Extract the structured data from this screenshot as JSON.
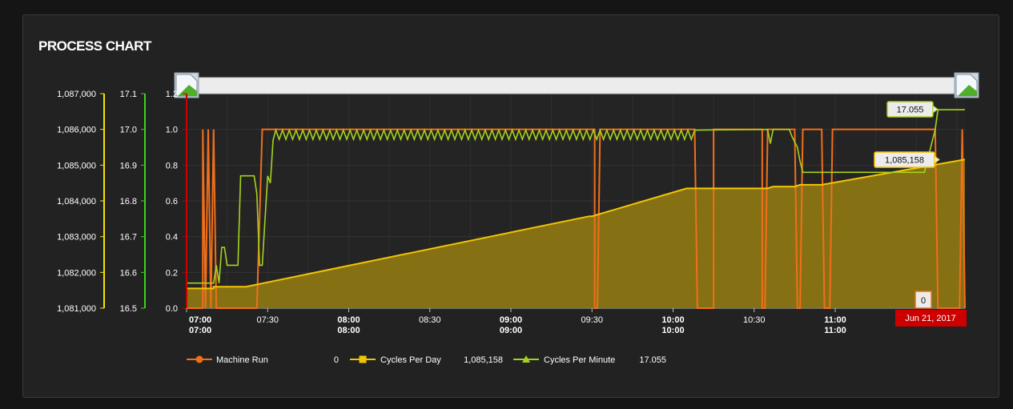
{
  "panel_title": "PROCESS CHART",
  "colors": {
    "machine_run": "#f26f1a",
    "cycles_per_day": "#f2c500",
    "cycles_per_day_fill": "#8b7514",
    "cycles_per_minute": "#a5d21e",
    "axis_day": "#f2e600",
    "axis_minute": "#3cd21e",
    "axis_run": "#cc0000",
    "date_flag": "#cc0000"
  },
  "chart_data": {
    "type": "line",
    "title": "PROCESS CHART",
    "x_range": [
      "07:00",
      "11:48"
    ],
    "x_ticks": [
      {
        "t": "07:00",
        "line1": "07:00",
        "line2": "07:00",
        "bold": true
      },
      {
        "t": "07:30",
        "line1": "07:30",
        "line2": "",
        "bold": false
      },
      {
        "t": "08:00",
        "line1": "08:00",
        "line2": "08:00",
        "bold": true
      },
      {
        "t": "08:30",
        "line1": "08:30",
        "line2": "",
        "bold": false
      },
      {
        "t": "09:00",
        "line1": "09:00",
        "line2": "09:00",
        "bold": true
      },
      {
        "t": "09:30",
        "line1": "09:30",
        "line2": "",
        "bold": false
      },
      {
        "t": "10:00",
        "line1": "10:00",
        "line2": "10:00",
        "bold": true
      },
      {
        "t": "10:30",
        "line1": "10:30",
        "line2": "",
        "bold": false
      },
      {
        "t": "11:00",
        "line1": "11:00",
        "line2": "11:00",
        "bold": true
      }
    ],
    "y_axes": {
      "cycles_per_day": {
        "min": 1081000,
        "max": 1087000,
        "ticks": [
          "1,081,000",
          "1,082,000",
          "1,083,000",
          "1,084,000",
          "1,085,000",
          "1,086,000",
          "1,087,000"
        ]
      },
      "cycles_per_minute": {
        "min": 16.5,
        "max": 17.1,
        "ticks": [
          "16.5",
          "16.6",
          "16.7",
          "16.8",
          "16.9",
          "17.0",
          "17.1"
        ]
      },
      "machine_run": {
        "min": 0,
        "max": 1.2,
        "ticks": [
          "0.0",
          "0.2",
          "0.4",
          "0.6",
          "0.8",
          "1.0",
          "1.2"
        ]
      }
    },
    "series": [
      {
        "name": "Machine Run",
        "axis": "machine_run",
        "legend_value": "0",
        "points": [
          [
            "07:00",
            0
          ],
          [
            "07:06",
            0
          ],
          [
            "07:06",
            1
          ],
          [
            "07:07",
            0
          ],
          [
            "07:08",
            1
          ],
          [
            "07:09",
            0
          ],
          [
            "07:10",
            1
          ],
          [
            "07:11",
            0
          ],
          [
            "07:26",
            0
          ],
          [
            "07:28",
            1
          ],
          [
            "09:31",
            1
          ],
          [
            "09:31",
            0
          ],
          [
            "09:32",
            0
          ],
          [
            "09:33",
            1
          ],
          [
            "10:08",
            1
          ],
          [
            "10:09",
            0
          ],
          [
            "10:15",
            0
          ],
          [
            "10:15",
            1
          ],
          [
            "10:33",
            1
          ],
          [
            "10:33",
            0
          ],
          [
            "10:34",
            0
          ],
          [
            "10:35",
            1
          ],
          [
            "10:45",
            1
          ],
          [
            "10:46",
            0
          ],
          [
            "10:47",
            0
          ],
          [
            "10:48",
            1
          ],
          [
            "10:55",
            1
          ],
          [
            "10:56",
            0
          ],
          [
            "10:58",
            0
          ],
          [
            "10:59",
            1
          ],
          [
            "11:37",
            1
          ],
          [
            "11:38",
            0
          ],
          [
            "11:46",
            0
          ],
          [
            "11:47",
            1
          ],
          [
            "11:48",
            0
          ]
        ]
      },
      {
        "name": "Cycles Per Day",
        "axis": "cycles_per_day",
        "legend_value": "1,085,158",
        "points": [
          [
            "07:00",
            1081550
          ],
          [
            "07:10",
            1081550
          ],
          [
            "07:10",
            1081600
          ],
          [
            "07:22",
            1081600
          ],
          [
            "09:29",
            1083570
          ],
          [
            "09:30",
            1083570
          ],
          [
            "10:05",
            1084350
          ],
          [
            "10:35",
            1084350
          ],
          [
            "10:37",
            1084400
          ],
          [
            "10:45",
            1084400
          ],
          [
            "10:47",
            1084450
          ],
          [
            "10:55",
            1084450
          ],
          [
            "11:48",
            1085158
          ]
        ]
      },
      {
        "name": "Cycles Per Minute",
        "axis": "cycles_per_minute",
        "legend_value": "17.055",
        "points": [
          [
            "07:00",
            16.57
          ],
          [
            "07:10",
            16.57
          ],
          [
            "07:11",
            16.62
          ],
          [
            "07:12",
            16.57
          ],
          [
            "07:13",
            16.67
          ],
          [
            "07:14",
            16.67
          ],
          [
            "07:15",
            16.62
          ],
          [
            "07:19",
            16.62
          ],
          [
            "07:20",
            16.87
          ],
          [
            "07:25",
            16.87
          ],
          [
            "07:26",
            16.82
          ],
          [
            "07:27",
            16.62
          ],
          [
            "07:28",
            16.62
          ],
          [
            "07:30",
            16.87
          ],
          [
            "07:31",
            16.85
          ],
          [
            "07:32",
            16.97
          ],
          [
            "07:33",
            17.02
          ],
          [
            "09:28",
            17.0
          ],
          [
            "09:29",
            16.96
          ],
          [
            "09:30",
            16.96
          ],
          [
            "09:31",
            17.0
          ],
          [
            "10:05",
            17.0
          ],
          [
            "10:06",
            16.96
          ],
          [
            "10:07",
            17.0
          ],
          [
            "10:35",
            17.0
          ],
          [
            "10:36",
            16.96
          ],
          [
            "10:37",
            17.0
          ],
          [
            "10:43",
            17.0
          ],
          [
            "10:44",
            16.98
          ],
          [
            "10:46",
            16.95
          ],
          [
            "10:47",
            16.91
          ],
          [
            "10:48",
            16.88
          ],
          [
            "10:53",
            16.88
          ],
          [
            "11:33",
            16.88
          ],
          [
            "11:37",
            17.0
          ],
          [
            "11:38",
            17.055
          ],
          [
            "11:47",
            17.055
          ],
          [
            "11:48",
            17.055
          ]
        ],
        "wiggle": {
          "from": "07:33",
          "to": "10:08",
          "base": 16.985,
          "amp": 0.013
        }
      }
    ],
    "tooltips": [
      {
        "series": "Cycles Per Minute",
        "value": "17.055"
      },
      {
        "series": "Cycles Per Day",
        "value": "1,085,158"
      },
      {
        "series": "Machine Run",
        "value": "0"
      }
    ],
    "date_flag": "Jun 21, 2017"
  }
}
